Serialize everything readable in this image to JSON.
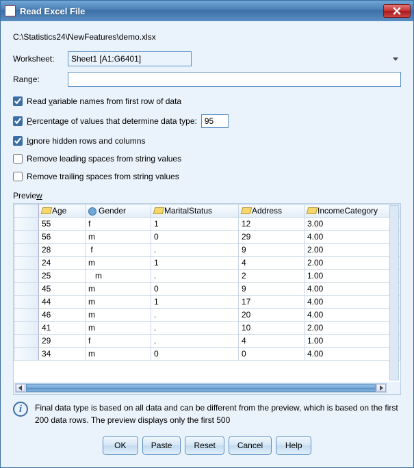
{
  "window": {
    "title": "Read Excel File"
  },
  "file_path": "C:\\Statistics24\\NewFeatures\\demo.xlsx",
  "worksheet": {
    "label": "Worksheet:",
    "value": "Sheet1 [A1:G6401]"
  },
  "range": {
    "label": "Range:",
    "value": ""
  },
  "options": {
    "read_varnames": {
      "label_pre": "Read ",
      "label_u": "v",
      "label_post": "ariable names from first row of data",
      "checked": true
    },
    "pct_values": {
      "label_pre": "",
      "label_u": "P",
      "label_post": "ercentage of values that determine data type:",
      "checked": true,
      "value": "95"
    },
    "ignore_hidden": {
      "label_pre": "",
      "label_u": "I",
      "label_post": "gnore hidden rows and columns",
      "checked": true
    },
    "remove_leading": {
      "label": "Remove leading spaces from string values",
      "checked": false
    },
    "remove_trailing": {
      "label": "Remove trailing spaces from string values",
      "checked": false
    }
  },
  "preview_label_pre": "Previe",
  "preview_label_u": "w",
  "columns": [
    {
      "name": "Age",
      "icon": "ruler"
    },
    {
      "name": "Gender",
      "icon": "person"
    },
    {
      "name": "MaritalStatus",
      "icon": "ruler"
    },
    {
      "name": "Address",
      "icon": "ruler"
    },
    {
      "name": "IncomeCategory",
      "icon": "ruler"
    }
  ],
  "rows": [
    {
      "Age": "55",
      "Gender": "f",
      "MaritalStatus": "1",
      "Address": "12",
      "IncomeCategory": "3.00"
    },
    {
      "Age": "56",
      "Gender": "m",
      "MaritalStatus": "0",
      "Address": "29",
      "IncomeCategory": "4.00"
    },
    {
      "Age": "28",
      "Gender": " f",
      "MaritalStatus": ".",
      "Address": "9",
      "IncomeCategory": "2.00"
    },
    {
      "Age": "24",
      "Gender": "m",
      "MaritalStatus": "1",
      "Address": "4",
      "IncomeCategory": "2.00"
    },
    {
      "Age": "25",
      "Gender": "   m",
      "MaritalStatus": ".",
      "Address": "2",
      "IncomeCategory": "1.00"
    },
    {
      "Age": "45",
      "Gender": "m",
      "MaritalStatus": "0",
      "Address": "9",
      "IncomeCategory": "4.00"
    },
    {
      "Age": "44",
      "Gender": "m",
      "MaritalStatus": "1",
      "Address": "17",
      "IncomeCategory": "4.00"
    },
    {
      "Age": "46",
      "Gender": "m",
      "MaritalStatus": ".",
      "Address": "20",
      "IncomeCategory": "4.00"
    },
    {
      "Age": "41",
      "Gender": "m",
      "MaritalStatus": ".",
      "Address": "10",
      "IncomeCategory": "2.00"
    },
    {
      "Age": "29",
      "Gender": "f",
      "MaritalStatus": ".",
      "Address": "4",
      "IncomeCategory": "1.00"
    },
    {
      "Age": "34",
      "Gender": "m",
      "MaritalStatus": "0",
      "Address": "0",
      "IncomeCategory": "4.00"
    }
  ],
  "info_text": "Final data type is based on all data and can be different from the preview, which is based on the first 200 data rows. The preview displays only the first 500",
  "buttons": {
    "ok": "OK",
    "paste": "Paste",
    "reset": "Reset",
    "cancel": "Cancel",
    "help": "Help"
  }
}
